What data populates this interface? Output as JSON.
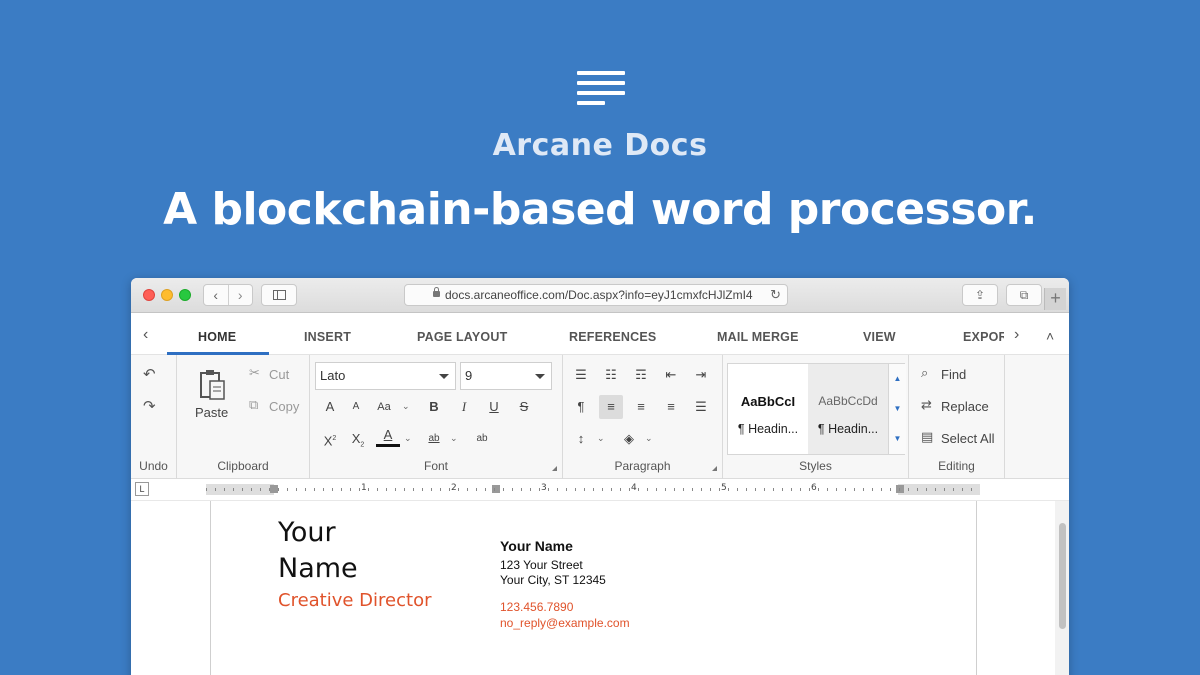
{
  "hero": {
    "app_name": "Arcane Docs",
    "tagline": "A blockchain-based word processor.",
    "logo_icon": "document-lines-icon"
  },
  "browser": {
    "url": "docs.arcaneoffice.com/Doc.aspx?info=eyJ1cmxfcHJlZmI4",
    "back_glyph": "‹",
    "forward_glyph": "›",
    "reload_glyph": "↻",
    "share_glyph": "⇪",
    "tabs_glyph": "⧉",
    "plus_glyph": "+"
  },
  "ribbon_tabs": {
    "prev_arrow": "‹",
    "next_arrow": "›",
    "collapse": "˄",
    "tabs": [
      "HOME",
      "INSERT",
      "PAGE LAYOUT",
      "REFERENCES",
      "MAIL MERGE",
      "VIEW",
      "EXPOR"
    ],
    "active": "HOME"
  },
  "ribbon": {
    "undo": {
      "label": "Undo"
    },
    "clipboard": {
      "label": "Clipboard",
      "paste": "Paste",
      "cut": "Cut",
      "copy": "Copy"
    },
    "font": {
      "label": "Font",
      "family": "Lato",
      "size": "9",
      "grow": "A",
      "shrink": "A",
      "case": "Aa",
      "bold": "B",
      "italic": "I",
      "underline": "U",
      "strike": "S",
      "superscript": "X",
      "subscript": "X",
      "font_color": "A",
      "highlight": "ab",
      "clear": "ab"
    },
    "paragraph": {
      "label": "Paragraph",
      "pilcrow": "¶"
    },
    "styles": {
      "label": "Styles",
      "items": [
        {
          "sample": "AaBbCcI",
          "name": "¶ Headin..."
        },
        {
          "sample": "AaBbCcDd",
          "name": "¶ Headin..."
        }
      ]
    },
    "editing": {
      "label": "Editing",
      "find": "Find",
      "replace": "Replace",
      "select_all": "Select All"
    }
  },
  "ruler": {
    "corner": "L",
    "numbers": [
      "1",
      "2",
      "3",
      "4",
      "5",
      "6"
    ]
  },
  "document": {
    "name_line1": "Your",
    "name_line2": "Name",
    "role": "Creative Director",
    "contact_name": "Your Name",
    "street": "123 Your Street",
    "city": "Your City, ST 12345",
    "phone": "123.456.7890",
    "email": "no_reply@example.com"
  },
  "colors": {
    "background": "#3b7cc4",
    "accent_text": "#e0532b",
    "active_tab_underline": "#2e6fc2"
  }
}
